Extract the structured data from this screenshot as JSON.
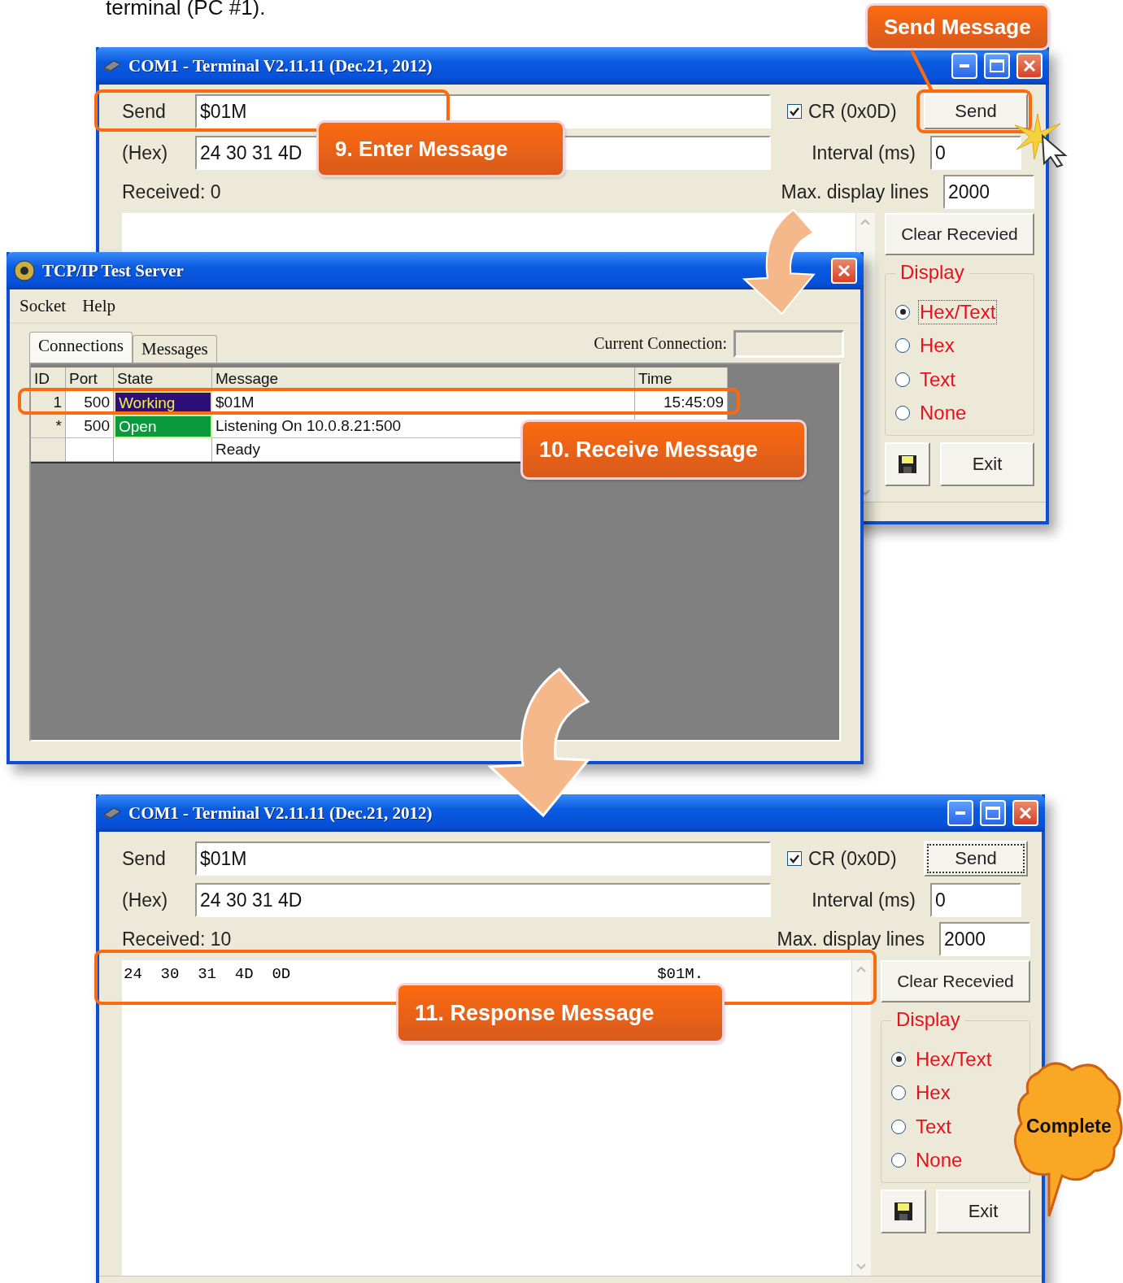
{
  "caption": "terminal (PC #1).",
  "terminals": [
    {
      "title": "COM1 - Terminal V2.11.11 (Dec.21, 2012)",
      "send_label": "Send",
      "send_value": "$01M",
      "hex_label": "(Hex)",
      "hex_value": "24 30 31 4D",
      "cr": {
        "label": "CR (0x0D)",
        "checked": true
      },
      "send_button": {
        "label": "Send",
        "focused": false
      },
      "interval_label": "Interval (ms)",
      "interval_value": "0",
      "max_lines_label": "Max. display lines",
      "max_lines_value": "2000",
      "received_label": "Received: 0",
      "clear_button": "Clear Recevied",
      "display": {
        "title": "Display",
        "options": [
          {
            "label": "Hex/Text",
            "selected": true,
            "focused": true
          },
          {
            "label": "Hex",
            "selected": false,
            "focused": false
          },
          {
            "label": "Text",
            "selected": false,
            "focused": false
          },
          {
            "label": "None",
            "selected": false,
            "focused": false
          }
        ]
      },
      "exit_button": "Exit"
    },
    {
      "title": "COM1 - Terminal V2.11.11 (Dec.21, 2012)",
      "send_label": "Send",
      "send_value": "$01M",
      "hex_label": "(Hex)",
      "hex_value": "24 30 31 4D",
      "cr": {
        "label": "CR (0x0D)",
        "checked": true
      },
      "send_button": {
        "label": "Send",
        "focused": true
      },
      "interval_label": "Interval (ms)",
      "interval_value": "0",
      "max_lines_label": "Max. display lines",
      "max_lines_value": "2000",
      "received_label": "Received: 10",
      "received_lines": [
        {
          "hex": "24  30  31  4D  0D",
          "text": "$01M."
        }
      ],
      "clear_button": "Clear Recevied",
      "display": {
        "title": "Display",
        "options": [
          {
            "label": "Hex/Text",
            "selected": true,
            "focused": false
          },
          {
            "label": "Hex",
            "selected": false,
            "focused": false
          },
          {
            "label": "Text",
            "selected": false,
            "focused": false
          },
          {
            "label": "None",
            "selected": false,
            "focused": false
          }
        ]
      },
      "exit_button": "Exit"
    }
  ],
  "tcp_server": {
    "title": "TCP/IP Test Server",
    "menu": [
      "Socket",
      "Help"
    ],
    "tabs": [
      {
        "label": "Connections",
        "selected": true
      },
      {
        "label": "Messages",
        "selected": false
      }
    ],
    "current_connection_label": "Current Connection:",
    "table": {
      "columns": [
        "ID",
        "Port",
        "State",
        "Message",
        "Time"
      ],
      "rows": [
        {
          "id": "1",
          "port": "500",
          "state": {
            "text": "Working",
            "kind": "working",
            "color": "#2e0f78"
          },
          "message": "$01M",
          "time": "15:45:09"
        },
        {
          "id": "*",
          "port": "500",
          "state": {
            "text": "Open",
            "kind": "open",
            "color": "#0a9a3c"
          },
          "message": "Listening On 10.0.8.21:500"
        },
        {
          "message": "Ready"
        }
      ]
    }
  },
  "callouts": [
    {
      "text": "Send Message"
    },
    {
      "text": "9. Enter Message"
    },
    {
      "text": "10. Receive Message"
    },
    {
      "text": "11. Response Message"
    }
  ],
  "complete_badge": "Complete"
}
